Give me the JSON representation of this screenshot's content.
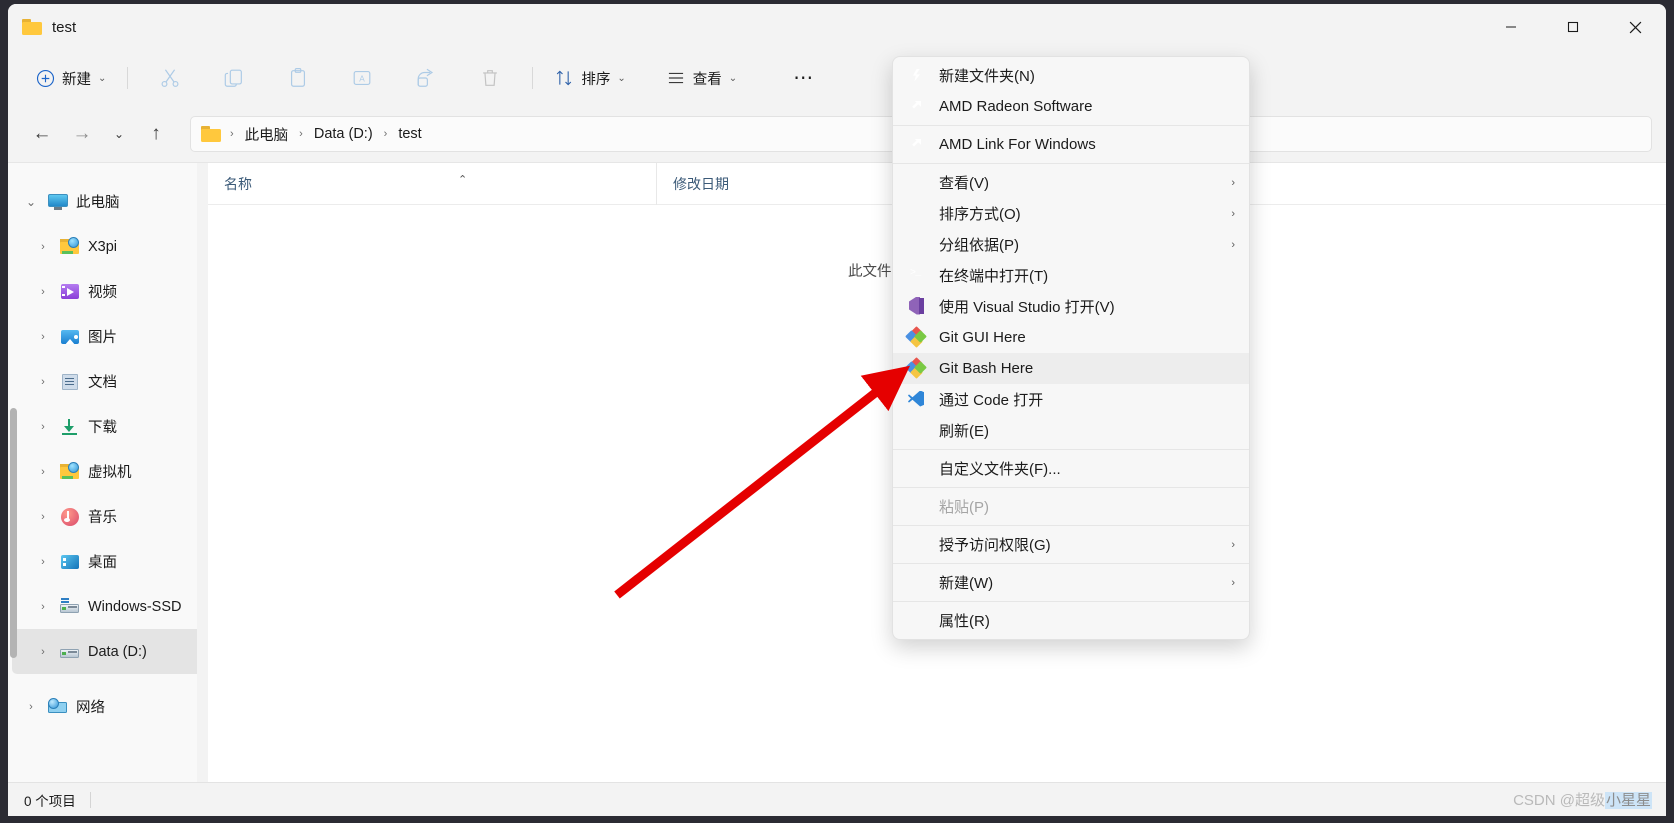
{
  "window": {
    "title": "test",
    "controls": {
      "minimize": "─",
      "maximize": "☐",
      "close": "✕"
    }
  },
  "toolbar": {
    "new_label": "新建",
    "new_caret": "⌄",
    "cut_icon": "scissors-icon",
    "copy_icon": "copy-icon",
    "paste_icon": "paste-icon",
    "rename_icon": "rename-icon",
    "share_icon": "share-icon",
    "delete_icon": "trash-icon",
    "sort_label": "排序",
    "sort_caret": "⌄",
    "view_label": "查看",
    "view_caret": "⌄",
    "more_label": "⋯"
  },
  "address": {
    "back": "←",
    "forward": "→",
    "recent": "⌄",
    "up": "↑",
    "crumbs": [
      "此电脑",
      "Data (D:)",
      "test"
    ],
    "separator": "›"
  },
  "sidebar": {
    "items": [
      {
        "label": "此电脑",
        "caret": "⌄",
        "icon": "monitor-icon",
        "indent": false,
        "selected": false
      },
      {
        "label": "X3pi",
        "caret": "›",
        "icon": "folder-globe-icon",
        "indent": true,
        "selected": false
      },
      {
        "label": "视频",
        "caret": "›",
        "icon": "video-icon",
        "indent": true,
        "selected": false
      },
      {
        "label": "图片",
        "caret": "›",
        "icon": "pictures-icon",
        "indent": true,
        "selected": false
      },
      {
        "label": "文档",
        "caret": "›",
        "icon": "documents-icon",
        "indent": true,
        "selected": false
      },
      {
        "label": "下载",
        "caret": "›",
        "icon": "downloads-icon",
        "indent": true,
        "selected": false
      },
      {
        "label": "虚拟机",
        "caret": "›",
        "icon": "folder-globe-icon",
        "indent": true,
        "selected": false
      },
      {
        "label": "音乐",
        "caret": "›",
        "icon": "music-icon",
        "indent": true,
        "selected": false
      },
      {
        "label": "桌面",
        "caret": "›",
        "icon": "desktop-icon",
        "indent": true,
        "selected": false
      },
      {
        "label": "Windows-SSD",
        "caret": "›",
        "icon": "drive-icon",
        "indent": true,
        "selected": false
      },
      {
        "label": "Data (D:)",
        "caret": "›",
        "icon": "drive-icon",
        "indent": true,
        "selected": true
      },
      {
        "label": "网络",
        "caret": "›",
        "icon": "network-icon",
        "indent": false,
        "selected": false
      }
    ]
  },
  "filelist": {
    "columns": [
      {
        "label": "名称",
        "sort_caret": "⌃"
      },
      {
        "label": "修改日期",
        "sort_caret": ""
      }
    ],
    "empty_message": "此文件夹为空。"
  },
  "statusbar": {
    "item_count": "0 个项目",
    "watermark_prefix": "CSDN @超级",
    "watermark_highlight": "小星星"
  },
  "context_menu": {
    "submenu_arrow": "›",
    "groups": [
      {
        "items": [
          {
            "label": "新建文件夹(N)",
            "icon": "lightning-circle-icon",
            "submenu": false,
            "disabled": false,
            "hovered": false
          },
          {
            "label": "AMD Radeon Software",
            "icon": "amd-icon",
            "submenu": false,
            "disabled": false,
            "hovered": false
          }
        ]
      },
      {
        "items": [
          {
            "label": "AMD Link For Windows",
            "icon": "amd-icon",
            "submenu": false,
            "disabled": false,
            "hovered": false
          }
        ]
      },
      {
        "items": [
          {
            "label": "查看(V)",
            "icon": "",
            "submenu": true,
            "disabled": false,
            "hovered": false
          },
          {
            "label": "排序方式(O)",
            "icon": "",
            "submenu": true,
            "disabled": false,
            "hovered": false
          },
          {
            "label": "分组依据(P)",
            "icon": "",
            "submenu": true,
            "disabled": false,
            "hovered": false
          },
          {
            "label": "在终端中打开(T)",
            "icon": "terminal-icon",
            "submenu": false,
            "disabled": false,
            "hovered": false
          },
          {
            "label": "使用 Visual Studio 打开(V)",
            "icon": "visual-studio-icon",
            "submenu": false,
            "disabled": false,
            "hovered": false
          },
          {
            "label": "Git GUI Here",
            "icon": "git-icon",
            "submenu": false,
            "disabled": false,
            "hovered": false
          },
          {
            "label": "Git Bash Here",
            "icon": "git-icon",
            "submenu": false,
            "disabled": false,
            "hovered": true
          },
          {
            "label": "通过 Code 打开",
            "icon": "vscode-icon",
            "submenu": false,
            "disabled": false,
            "hovered": false
          },
          {
            "label": "刷新(E)",
            "icon": "",
            "submenu": false,
            "disabled": false,
            "hovered": false
          }
        ]
      },
      {
        "items": [
          {
            "label": "自定义文件夹(F)...",
            "icon": "",
            "submenu": false,
            "disabled": false,
            "hovered": false
          }
        ]
      },
      {
        "items": [
          {
            "label": "粘贴(P)",
            "icon": "",
            "submenu": false,
            "disabled": true,
            "hovered": false
          }
        ]
      },
      {
        "items": [
          {
            "label": "授予访问权限(G)",
            "icon": "",
            "submenu": true,
            "disabled": false,
            "hovered": false
          }
        ]
      },
      {
        "items": [
          {
            "label": "新建(W)",
            "icon": "",
            "submenu": true,
            "disabled": false,
            "hovered": false
          }
        ]
      },
      {
        "items": [
          {
            "label": "属性(R)",
            "icon": "",
            "submenu": false,
            "disabled": false,
            "hovered": false
          }
        ]
      }
    ]
  },
  "annotation": {
    "arrow_color": "#e50000"
  }
}
